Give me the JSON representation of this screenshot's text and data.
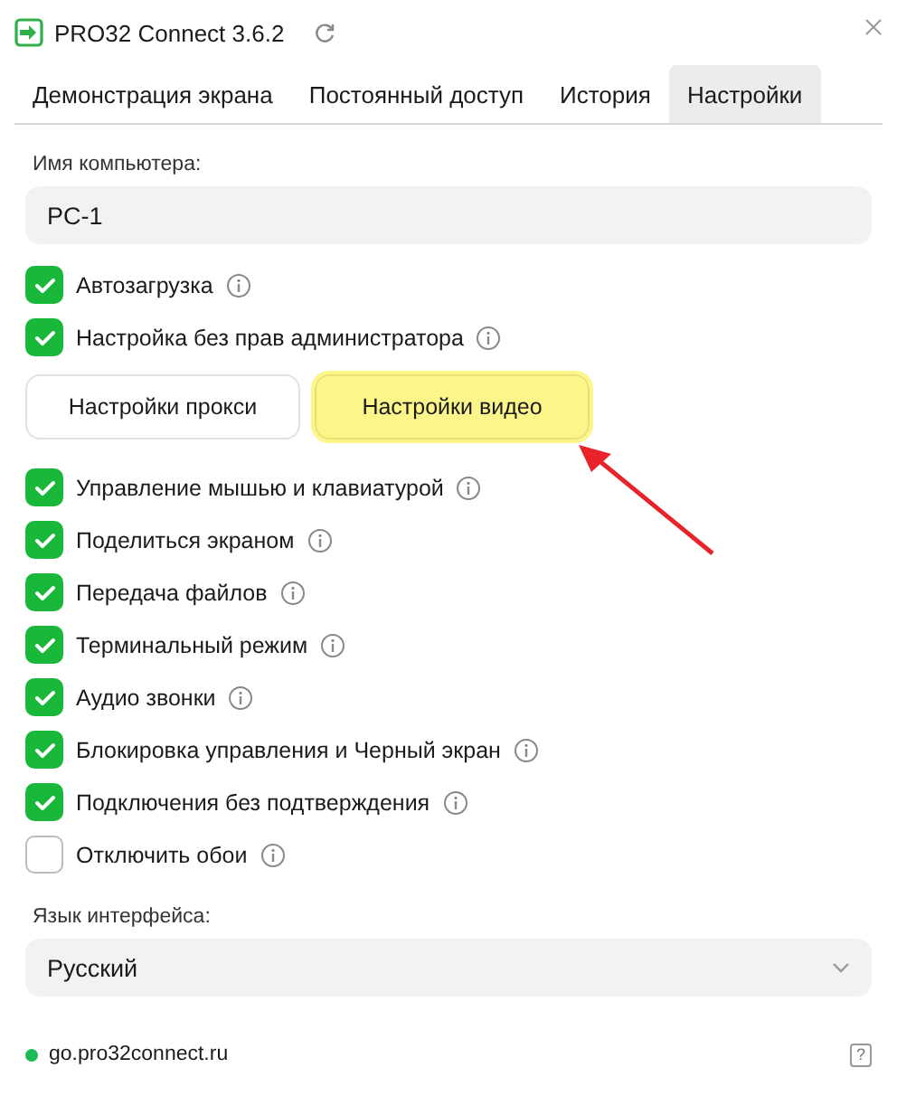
{
  "window": {
    "title": "PRO32 Connect 3.6.2"
  },
  "tabs": [
    {
      "label": "Демонстрация экрана",
      "selected": false
    },
    {
      "label": "Постоянный доступ",
      "selected": false
    },
    {
      "label": "История",
      "selected": false
    },
    {
      "label": "Настройки",
      "selected": true
    }
  ],
  "computer_name": {
    "label": "Имя компьютера:",
    "value": "PC-1"
  },
  "top_options": [
    {
      "label": "Автозагрузка",
      "checked": true
    },
    {
      "label": "Настройка без прав администратора",
      "checked": true
    }
  ],
  "buttons": [
    {
      "label": "Настройки прокси",
      "highlighted": false
    },
    {
      "label": "Настройки видео",
      "highlighted": true
    }
  ],
  "annotation_arrow": true,
  "options": [
    {
      "label": "Управление мышью и клавиатурой",
      "checked": true
    },
    {
      "label": "Поделиться экраном",
      "checked": true
    },
    {
      "label": "Передача файлов",
      "checked": true
    },
    {
      "label": "Терминальный режим",
      "checked": true
    },
    {
      "label": "Аудио звонки",
      "checked": true
    },
    {
      "label": "Блокировка управления и Черный экран",
      "checked": true
    },
    {
      "label": "Подключения без подтверждения",
      "checked": true
    },
    {
      "label": "Отключить обои",
      "checked": false
    }
  ],
  "language": {
    "label": "Язык интерфейса:",
    "value": "Русский"
  },
  "status_bar": {
    "server": "go.pro32connect.ru",
    "color": "#1db954",
    "help": "?"
  }
}
